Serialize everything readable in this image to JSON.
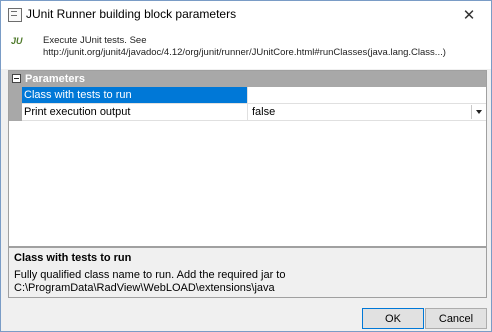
{
  "window": {
    "title": "JUnit Runner building block parameters",
    "close_glyph": "✕"
  },
  "header": {
    "logo_j": "J",
    "logo_u": "U",
    "description_line1": "Execute JUnit tests. See",
    "description_line2": "http://junit.org/junit4/javadoc/4.12/org/junit/runner/JUnitCore.html#runClasses(java.lang.Class...)"
  },
  "grid": {
    "group_label": "Parameters",
    "rows": [
      {
        "name": "Class with tests to run",
        "value": "",
        "selected": true
      },
      {
        "name": "Print execution output",
        "value": "false",
        "has_dropdown": true
      }
    ]
  },
  "help": {
    "title": "Class with tests to run",
    "line1": "Fully qualified class name to run. Add the required jar to",
    "line2": "C:\\ProgramData\\RadView\\WebLOAD\\extensions\\java"
  },
  "buttons": {
    "ok": "OK",
    "cancel": "Cancel"
  },
  "colors": {
    "selection": "#0078d7",
    "group_header": "#a8a8a8"
  }
}
